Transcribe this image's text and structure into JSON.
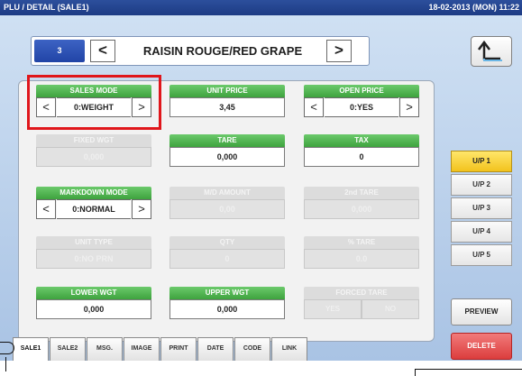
{
  "title_bar": {
    "left": "PLU / DETAIL (SALE1)",
    "right": "18-02-2013 (MON) 11:22"
  },
  "plu": {
    "number": "3",
    "name": "RAISIN ROUGE/RED GRAPE",
    "prev_icon": "chevron-left-icon",
    "next_icon": "chevron-right-icon"
  },
  "back_icon": "return-arrow-icon",
  "fields": {
    "sales_mode": {
      "label": "SALES MODE",
      "value": "0:WEIGHT"
    },
    "unit_price": {
      "label": "UNIT PRICE",
      "value": "3,45"
    },
    "open_price": {
      "label": "OPEN PRICE",
      "value": "0:YES"
    },
    "fixed_wgt": {
      "label": "FIXED WGT",
      "value": "0,000"
    },
    "tare": {
      "label": "TARE",
      "value": "0,000"
    },
    "tax": {
      "label": "TAX",
      "value": "0"
    },
    "markdown_mode": {
      "label": "MARKDOWN MODE",
      "value": "0:NORMAL"
    },
    "md_amount": {
      "label": "M/D AMOUNT",
      "value": "0,00"
    },
    "second_tare": {
      "label": "2nd TARE",
      "value": "0,000"
    },
    "unit_type": {
      "label": "UNIT TYPE",
      "value": "0:NO PRN"
    },
    "qty": {
      "label": "QTY",
      "value": "0"
    },
    "pct_tare": {
      "label": "% TARE",
      "value": "0.0"
    },
    "lower_wgt": {
      "label": "LOWER WGT",
      "value": "0,000"
    },
    "upper_wgt": {
      "label": "UPPER WGT",
      "value": "0,000"
    },
    "forced_tare": {
      "label": "FORCED TARE",
      "yes": "YES",
      "no": "NO"
    }
  },
  "unit_price_buttons": [
    "U/P 1",
    "U/P 2",
    "U/P 3",
    "U/P 4",
    "U/P 5"
  ],
  "active_unit_price": "U/P 1",
  "preview_label": "PREVIEW",
  "delete_label": "DELETE",
  "tabs": [
    "SALE1",
    "SALE2",
    "MSG.",
    "IMAGE",
    "PRINT",
    "DATE",
    "CODE",
    "LINK"
  ],
  "active_tab": "SALE1",
  "colors": {
    "title_bar": "#1d3b84",
    "field_header": "#3ea33e",
    "highlight": "#e0161b",
    "active_up": "#f2c31d",
    "delete": "#dc3d3d"
  }
}
